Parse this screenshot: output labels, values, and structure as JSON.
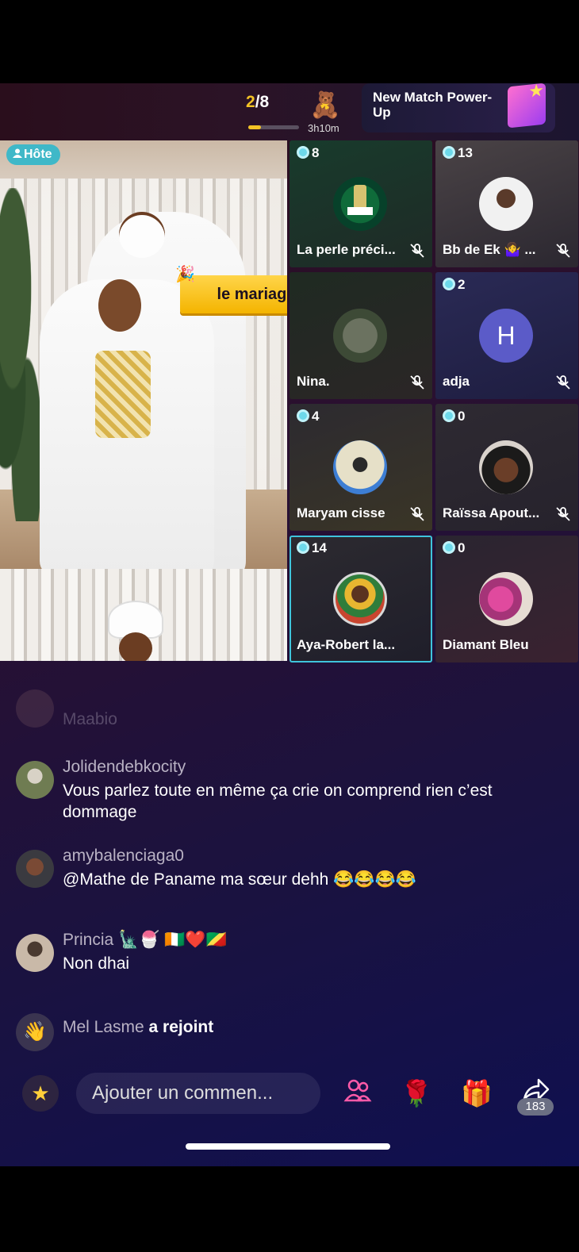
{
  "top_bar": {
    "round_current": "2",
    "round_total": "/8",
    "round_progress": 0.25,
    "timer": "3h10m",
    "powerup_title": "New Match Power-Up"
  },
  "host": {
    "badge": "Hôte",
    "banner": "le mariage"
  },
  "guests": [
    {
      "count": "8",
      "name": "La perle préci...",
      "muted": true
    },
    {
      "count": "13",
      "name": "Bb de Ek 🤷‍♀️ ...",
      "muted": true
    },
    {
      "count": "2",
      "name": "Nina.",
      "muted": true
    },
    {
      "count": "2",
      "name": "adja",
      "muted": true,
      "initial": "H"
    },
    {
      "count": "4",
      "name": "Maryam cisse",
      "muted": true
    },
    {
      "count": "0",
      "name": "Raïssa Apout...",
      "muted": true
    },
    {
      "count": "14",
      "name": "Aya-Robert la...",
      "muted": false,
      "selected": true
    },
    {
      "count": "0",
      "name": "Diamant Bleu",
      "muted": false
    }
  ],
  "chat": [
    {
      "user": "Maabio",
      "text": ""
    },
    {
      "user": "Jolidendebkocity",
      "text": "Vous parlez toute en même ça crie on comprend rien c’est dommage"
    },
    {
      "user": "amybalenciaga0",
      "text": "@Mathe de Paname ma sœur dehh 😂😂😂😂"
    },
    {
      "user": "Princia 🗽🍧 🇨🇮❤️🇨🇬",
      "text": "Non dhai"
    },
    {
      "user": "Mel Lasme",
      "action": "a rejoint"
    }
  ],
  "bottom_bar": {
    "comment_placeholder": "Ajouter un commen...",
    "share_count": "183"
  },
  "colors": {
    "accent_cyan": "#3fb8c8",
    "gold": "#f3c325"
  }
}
